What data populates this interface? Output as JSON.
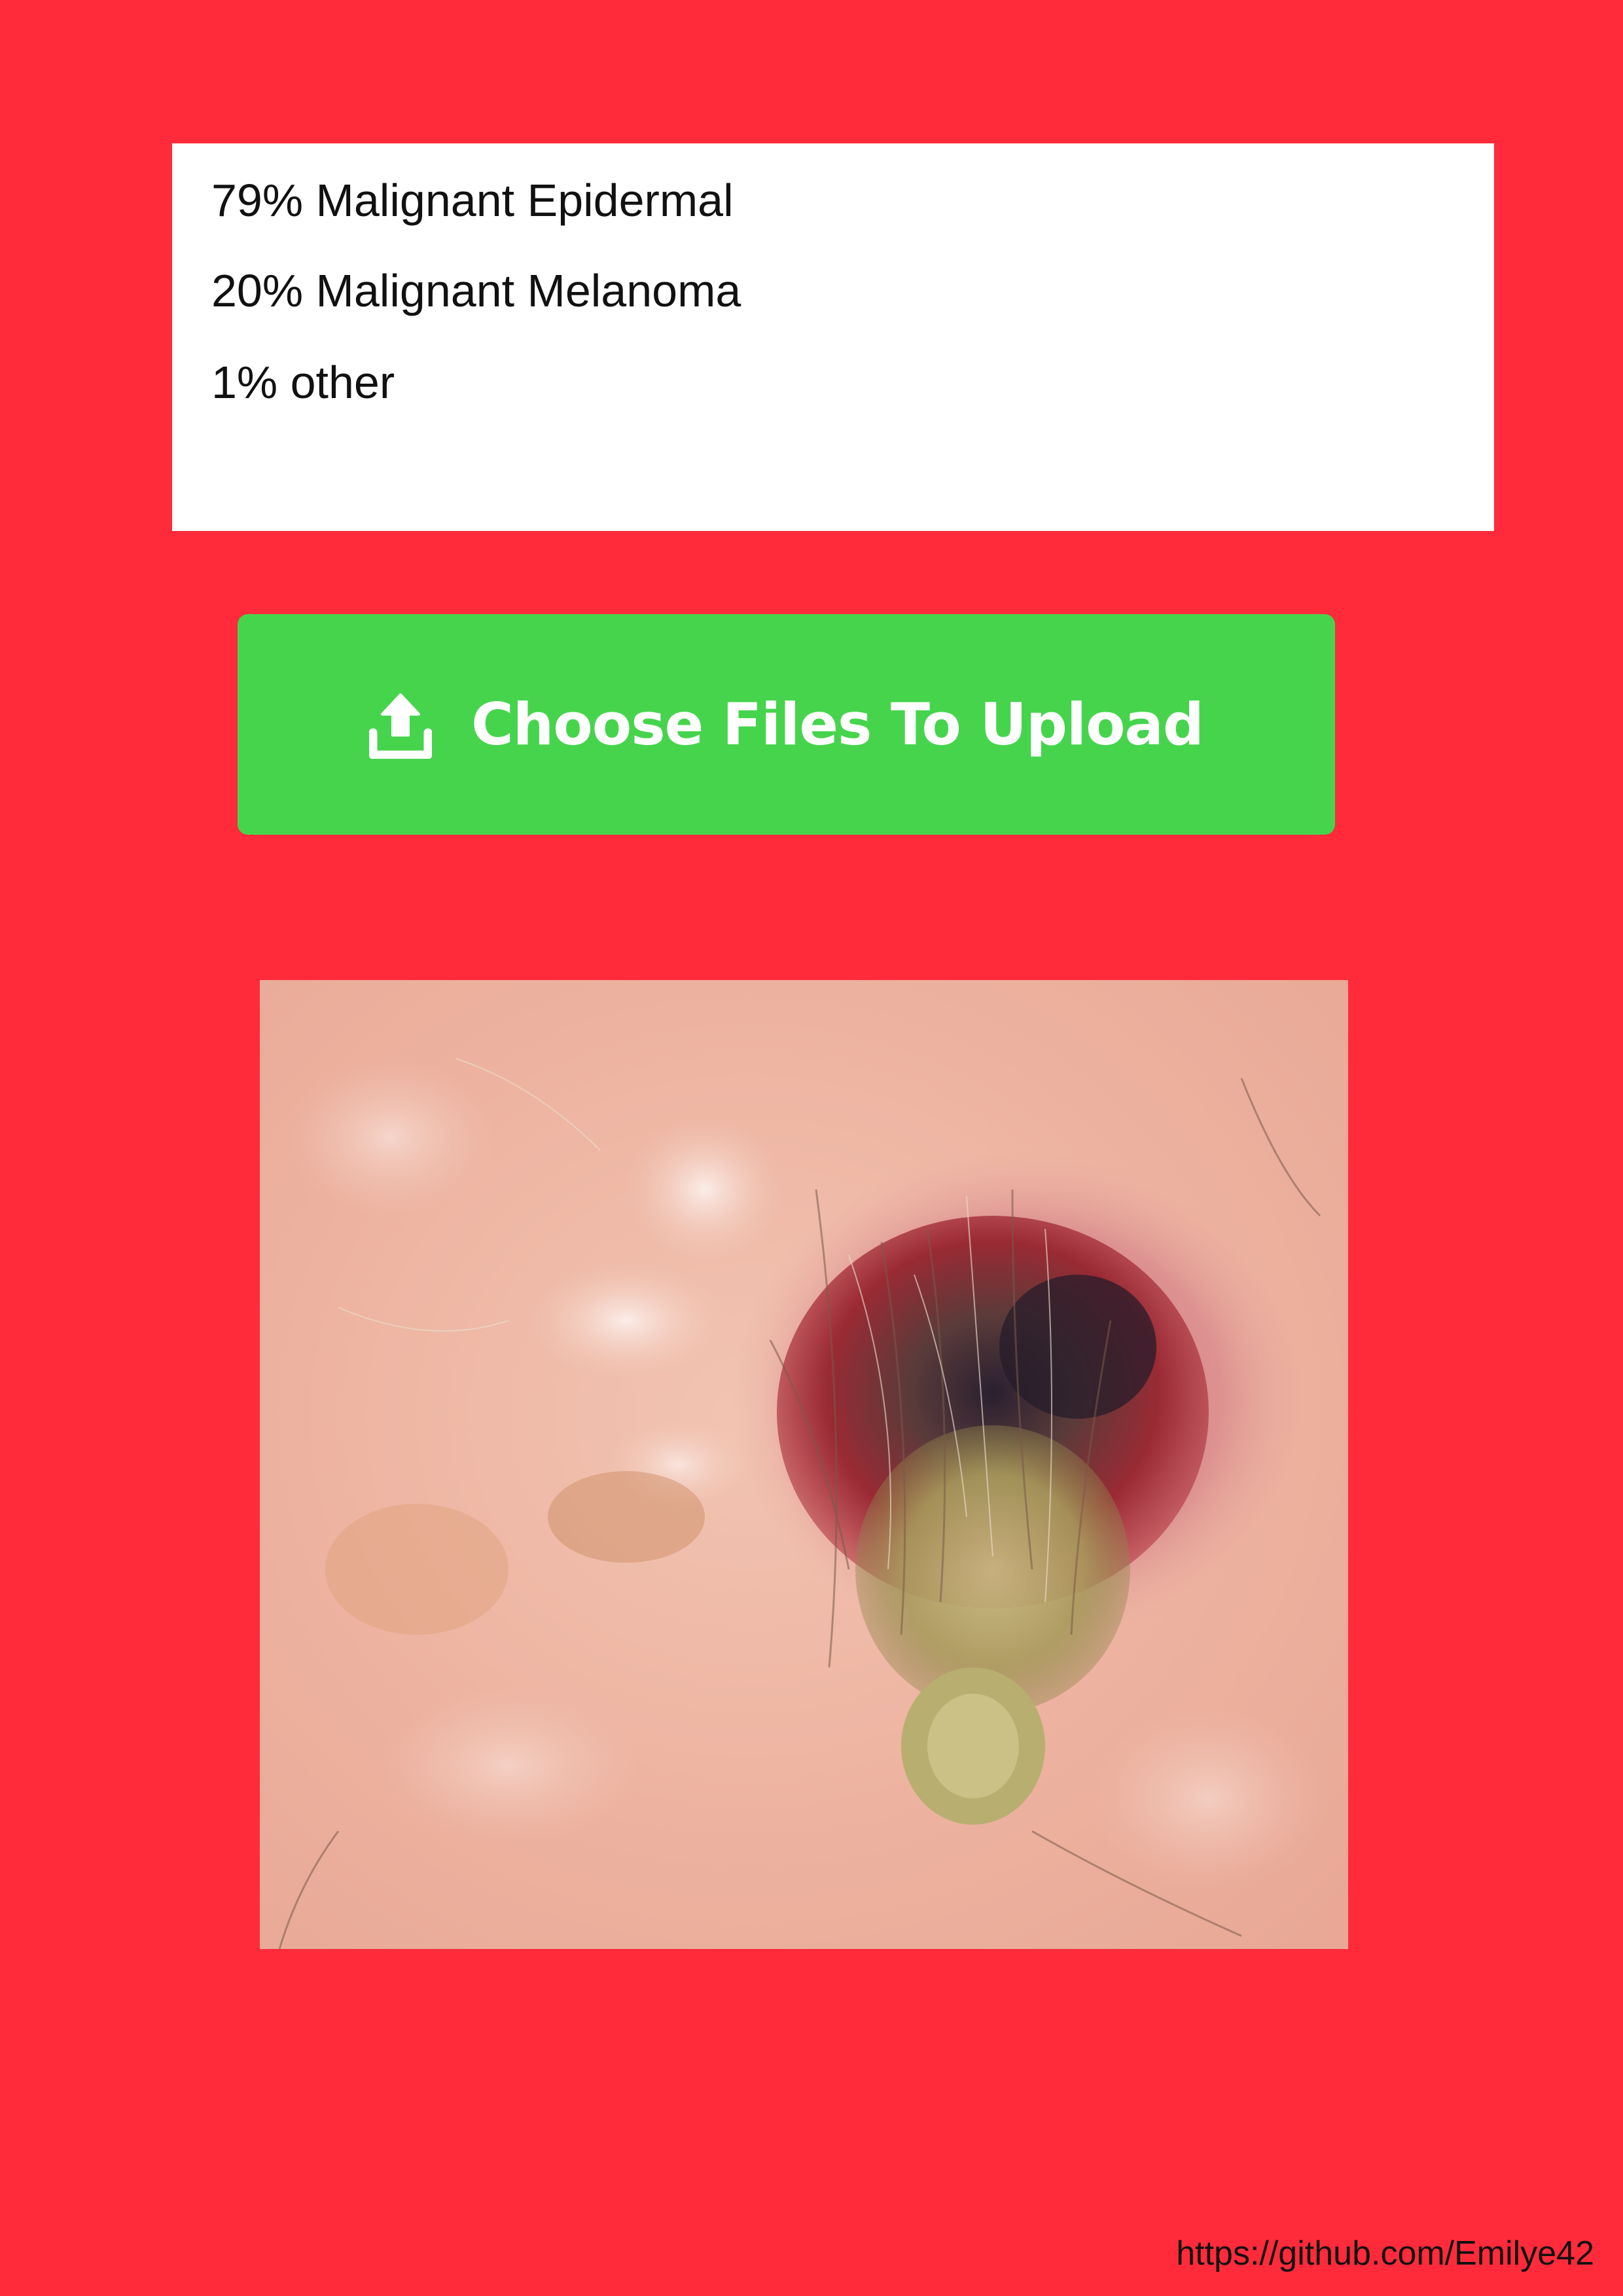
{
  "results": {
    "lines": [
      "79% Malignant Epidermal",
      "20% Malignant Melanoma",
      "1% other"
    ]
  },
  "upload": {
    "label": "Choose Files To Upload",
    "icon": "upload-icon"
  },
  "photo": {
    "subject": "skin-lesion-photo"
  },
  "footer": {
    "link": "https://github.com/Emilye42"
  },
  "colors": {
    "background": "#FF2B3B",
    "button": "#47D44D",
    "panel": "#FFFFFF"
  }
}
